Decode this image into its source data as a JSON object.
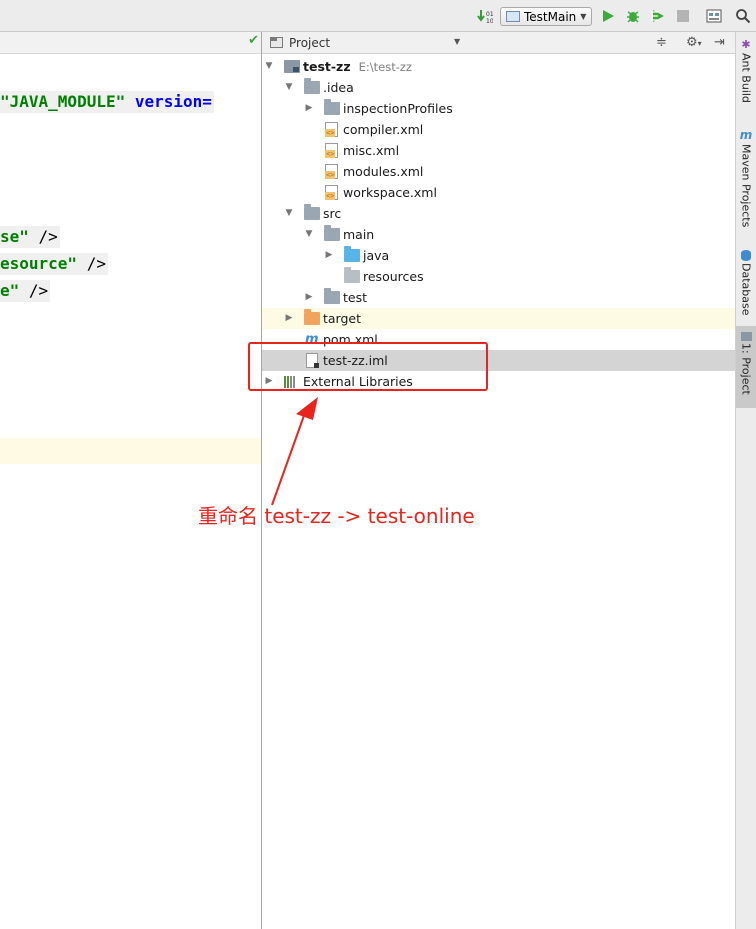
{
  "toolbar": {
    "run_config": "TestMain"
  },
  "editor": {
    "lines": [
      {
        "str": "\"JAVA_MODULE\"",
        "attr": " version="
      },
      {
        "str": "se\"",
        "tail": " />"
      },
      {
        "str": "esource\"",
        "tail": " />"
      },
      {
        "str": "e\"",
        "tail": " />"
      }
    ]
  },
  "project_panel": {
    "title": "Project",
    "tree": {
      "root_name": "test-zz",
      "root_path": "E:\\test-zz",
      "idea": ".idea",
      "inspection_profiles": "inspectionProfiles",
      "compiler_xml": "compiler.xml",
      "misc_xml": "misc.xml",
      "modules_xml": "modules.xml",
      "workspace_xml": "workspace.xml",
      "src": "src",
      "main": "main",
      "java": "java",
      "resources": "resources",
      "test": "test",
      "target": "target",
      "pom_xml": "pom.xml",
      "iml": "test-zz.iml",
      "external_libraries": "External Libraries"
    }
  },
  "right_strip": {
    "tabs": [
      "Ant Build",
      "Maven Projects",
      "Database",
      "1: Project"
    ]
  },
  "annotation": {
    "text": "重命名 test-zz -> test-online",
    "color": "#e8241d"
  }
}
